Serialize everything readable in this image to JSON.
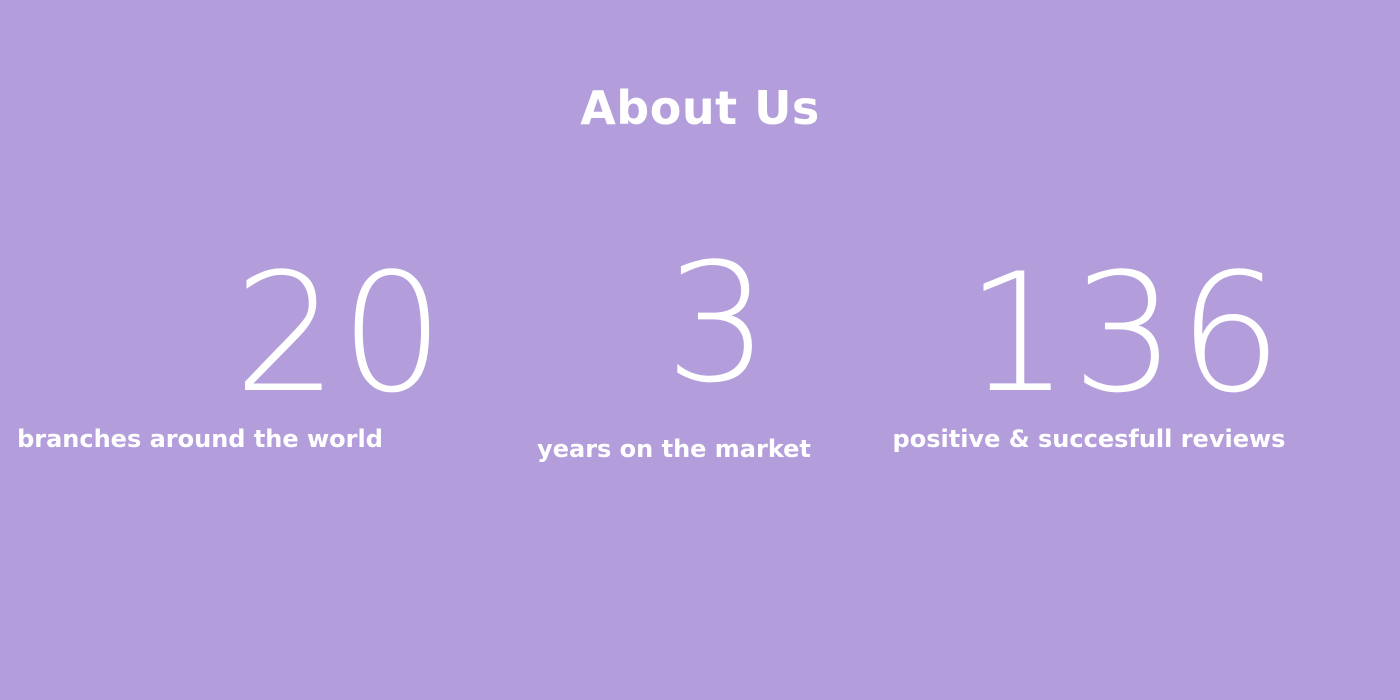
{
  "page": {
    "title": "About Us",
    "background_color": "#b39edb",
    "text_color": "#ffffff"
  },
  "stats": [
    {
      "number": "20",
      "label": "branches around the world"
    },
    {
      "number": "3",
      "label": "years on the market"
    },
    {
      "number": "136",
      "label": "positive & succesfull reviews"
    }
  ]
}
